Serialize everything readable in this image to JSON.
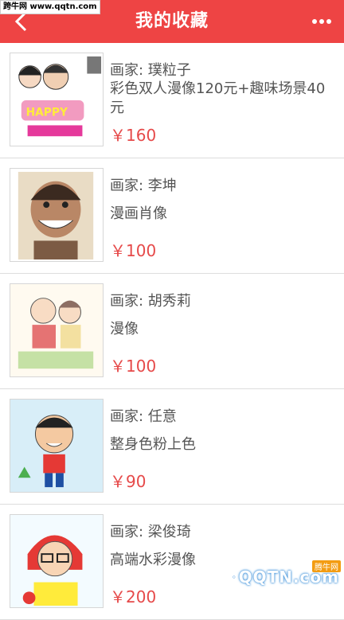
{
  "watermark": "跨牛网 www.qqtn.com",
  "header": {
    "title": "我的收藏"
  },
  "currency": "￥",
  "items": [
    {
      "artist": "画家: 璞粒子",
      "desc": "彩色双人漫像120元+趣味场景40元",
      "price": "￥160"
    },
    {
      "artist": "画家: 李坤",
      "desc": "漫画肖像",
      "price": "￥100"
    },
    {
      "artist": "画家: 胡秀莉",
      "desc": "漫像",
      "price": "￥100"
    },
    {
      "artist": "画家: 任意",
      "desc": "整身色粉上色",
      "price": "￥90"
    },
    {
      "artist": "画家: 梁俊琦",
      "desc": "高端水彩漫像",
      "price": "￥200"
    }
  ],
  "logo": {
    "text": "QQTN.com",
    "badge": "腾牛网"
  },
  "colors": {
    "header": "#ee4444",
    "price": "#e64a4a"
  }
}
